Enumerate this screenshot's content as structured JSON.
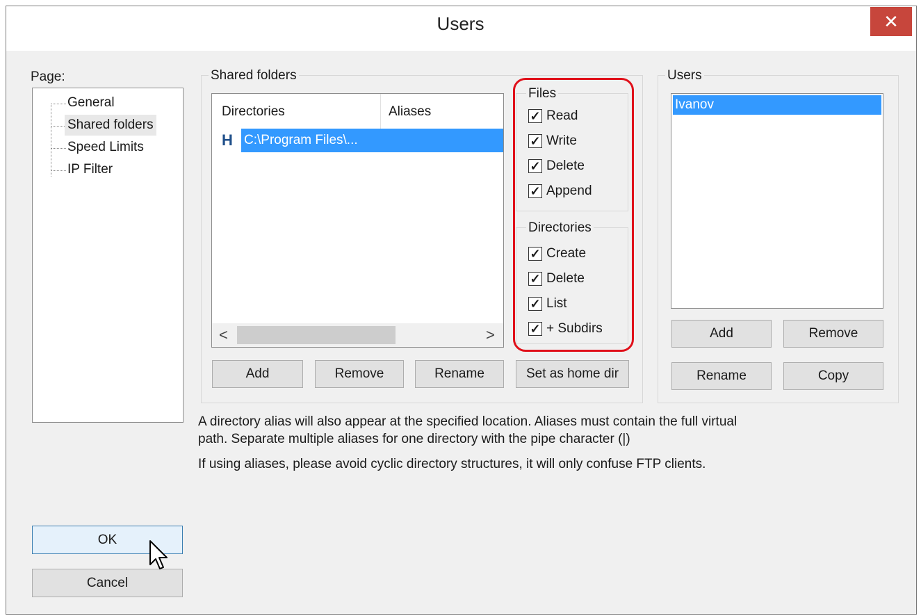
{
  "window": {
    "title": "Users",
    "close_glyph": "✕"
  },
  "page_label": "Page:",
  "tree": {
    "items": [
      {
        "label": "General",
        "selected": false
      },
      {
        "label": "Shared folders",
        "selected": true
      },
      {
        "label": "Speed Limits",
        "selected": false
      },
      {
        "label": "IP Filter",
        "selected": false
      }
    ]
  },
  "shared_folders": {
    "group_label": "Shared folders",
    "columns": [
      "Directories",
      "Aliases"
    ],
    "rows": [
      {
        "home_marker": "H",
        "directory": "C:\\Program Files\\...",
        "alias": ""
      }
    ],
    "scroll_left": "<",
    "scroll_right": ">",
    "buttons": {
      "add": "Add",
      "remove": "Remove",
      "rename": "Rename",
      "home": "Set as home dir"
    }
  },
  "files": {
    "group_label": "Files",
    "options": [
      {
        "label": "Read",
        "checked": true
      },
      {
        "label": "Write",
        "checked": true
      },
      {
        "label": "Delete",
        "checked": true
      },
      {
        "label": "Append",
        "checked": true
      }
    ]
  },
  "directories": {
    "group_label": "Directories",
    "options": [
      {
        "label": "Create",
        "checked": true
      },
      {
        "label": "Delete",
        "checked": true
      },
      {
        "label": "List",
        "checked": true
      },
      {
        "label": "+ Subdirs",
        "checked": true
      }
    ]
  },
  "users": {
    "group_label": "Users",
    "list": [
      "Ivanov"
    ],
    "buttons": {
      "add": "Add",
      "remove": "Remove",
      "rename": "Rename",
      "copy": "Copy"
    }
  },
  "info": {
    "line1": "A directory alias will also appear at the specified location. Aliases must contain the full virtual",
    "line2": "path. Separate multiple aliases for one directory with the pipe character (|)",
    "line3": "If using aliases, please avoid cyclic directory structures, it will only confuse FTP clients."
  },
  "dialog_buttons": {
    "ok": "OK",
    "cancel": "Cancel"
  },
  "check_glyph": "✓",
  "colors": {
    "selection": "#3399ff",
    "highlight_box": "#e0101a",
    "close_button": "#c7463c"
  }
}
